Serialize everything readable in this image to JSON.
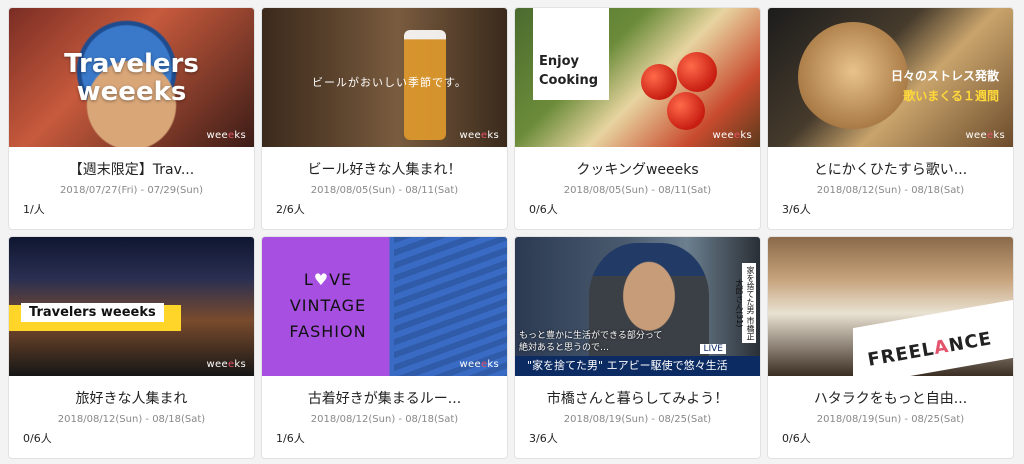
{
  "watermark": {
    "prefix": "wee",
    "accent": "e",
    "suffix": "ks"
  },
  "cards": [
    {
      "title": "【週末限定】Trav...",
      "dates": "2018/07/27(Fri) - 07/29(Sun)",
      "count": "1/人",
      "thumb_text": "Travelers weeeks"
    },
    {
      "title": "ビール好きな人集まれ！",
      "dates": "2018/08/05(Sun) - 08/11(Sat)",
      "count": "2/6人",
      "thumb_text": "ビールがおいしい季節です。"
    },
    {
      "title": "クッキングweeeks",
      "dates": "2018/08/05(Sun) - 08/11(Sat)",
      "count": "0/6人",
      "thumb_text_1": "Enjoy",
      "thumb_text_2": "Cooking"
    },
    {
      "title": "とにかくひたすら歌い...",
      "dates": "2018/08/12(Sun) - 08/18(Sat)",
      "count": "3/6人",
      "thumb_text_1": "日々のストレス発散",
      "thumb_text_2": "歌いまくる１週間"
    },
    {
      "title": "旅好きな人集まれ",
      "dates": "2018/08/12(Sun) - 08/18(Sat)",
      "count": "0/6人",
      "thumb_text": "Travelers weeeks"
    },
    {
      "title": "古着好きが集まるルー...",
      "dates": "2018/08/12(Sun) - 08/18(Sat)",
      "count": "1/6人",
      "thumb_text_1a": "L",
      "thumb_text_1b": "♥",
      "thumb_text_1c": "VE",
      "thumb_text_2": "VINTAGE",
      "thumb_text_3": "FASHION"
    },
    {
      "title": "市橋さんと暮らしてみよう！",
      "dates": "2018/08/19(Sun) - 08/25(Sat)",
      "count": "3/6人",
      "thumb_caption": "\"家を捨てた男\" エアビー駆使で悠々生活",
      "thumb_sub_1": "もっと豊かに生活ができる部分って",
      "thumb_sub_2": "絶対あると思うので…",
      "thumb_live": "LIVE",
      "thumb_side": "家を捨てた男 市橋正太郎さん(31)"
    },
    {
      "title": "ハタラクをもっと自由...",
      "dates": "2018/08/19(Sun) - 08/25(Sat)",
      "count": "0/6人",
      "thumb_text_a": "FREEL",
      "thumb_text_b": "A",
      "thumb_text_c": "NCE"
    }
  ]
}
